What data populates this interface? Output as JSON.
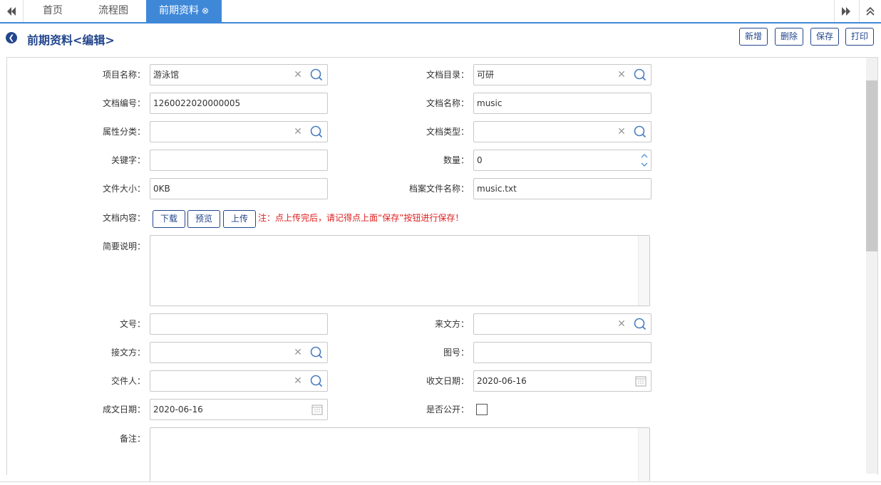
{
  "tabs": {
    "home": "首页",
    "flowchart": "流程图",
    "active": "前期资料",
    "close_glyph": "⊗"
  },
  "header": {
    "title": "前期资料<编辑>",
    "buttons": {
      "add": "新增",
      "delete": "删除",
      "save": "保存",
      "print": "打印"
    }
  },
  "form": {
    "project_name": {
      "label": "项目名称：",
      "value": "游泳馆"
    },
    "doc_catalog": {
      "label": "文档目录：",
      "value": "可研"
    },
    "doc_number": {
      "label": "文档编号：",
      "value": "1260022020000005"
    },
    "doc_name": {
      "label": "文档名称：",
      "value": "music"
    },
    "attr_category": {
      "label": "属性分类：",
      "value": ""
    },
    "doc_type": {
      "label": "文档类型：",
      "value": ""
    },
    "keyword": {
      "label": "关键字：",
      "value": ""
    },
    "quantity": {
      "label": "数量：",
      "value": "0"
    },
    "file_size": {
      "label": "文件大小：",
      "value": "0KB"
    },
    "archive_file_name": {
      "label": "档案文件名称：",
      "value": "music.txt"
    },
    "doc_content": {
      "label": "文档内容：",
      "download": "下载",
      "preview": "预览",
      "upload": "上传",
      "note": "注：点上传完后，请记得点上面“保存”按钮进行保存！"
    },
    "summary": {
      "label": "简要说明：",
      "value": ""
    },
    "doc_no": {
      "label": "文号：",
      "value": ""
    },
    "sender": {
      "label": "来文方：",
      "value": ""
    },
    "receiver": {
      "label": "接文方：",
      "value": ""
    },
    "drawing_no": {
      "label": "图号：",
      "value": ""
    },
    "submitter": {
      "label": "交件人：",
      "value": ""
    },
    "receive_date": {
      "label": "收文日期：",
      "value": "2020-06-16"
    },
    "create_date": {
      "label": "成文日期：",
      "value": "2020-06-16"
    },
    "is_public": {
      "label": "是否公开：",
      "checked": false
    },
    "remarks": {
      "label": "备注：",
      "value": ""
    }
  },
  "colors": {
    "accent": "#3f88d8",
    "title": "#23468c",
    "note": "#e01e1e"
  }
}
